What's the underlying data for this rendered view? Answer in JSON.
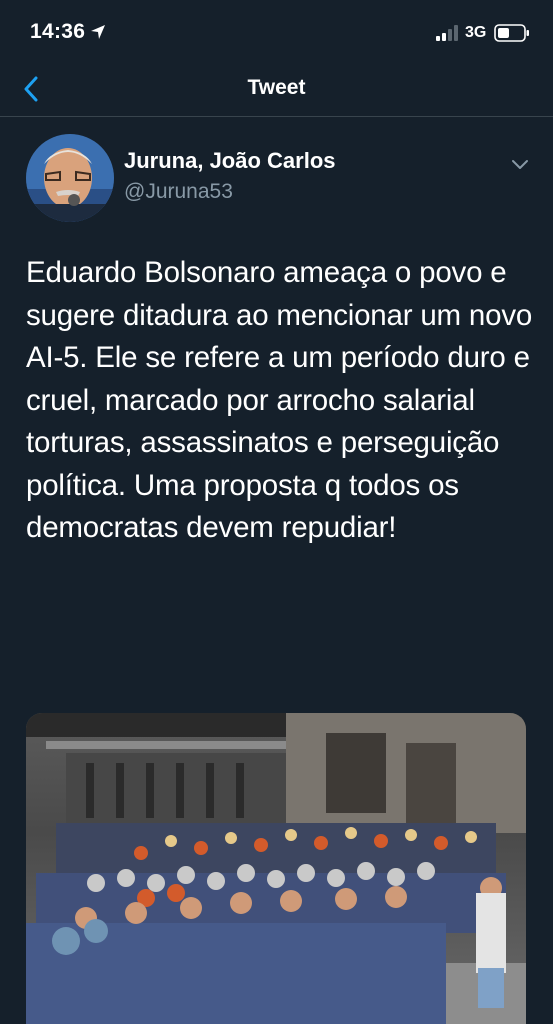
{
  "status_bar": {
    "time": "14:36",
    "network": "3G",
    "icons": [
      "location-arrow-icon",
      "signal-bars-icon",
      "battery-icon"
    ]
  },
  "header": {
    "back_icon": "chevron-left-icon",
    "title": "Tweet"
  },
  "tweet": {
    "author_name": "Juruna, João Carlos",
    "author_handle": "@Juruna53",
    "more_icon": "chevron-down-icon",
    "text": "Eduardo Bolsonaro ameaça o povo e sugere ditadura ao mencionar um novo AI-5. Ele se refere a um período duro e cruel, marcado por arrocho salarial torturas, assassinatos e perseguição política. Uma proposta q todos os democratas devem repudiar!",
    "media": "photo"
  },
  "colors": {
    "background": "#15202b",
    "accent": "#1da1f2",
    "secondary_text": "#8899a6",
    "divider": "#38444d"
  }
}
